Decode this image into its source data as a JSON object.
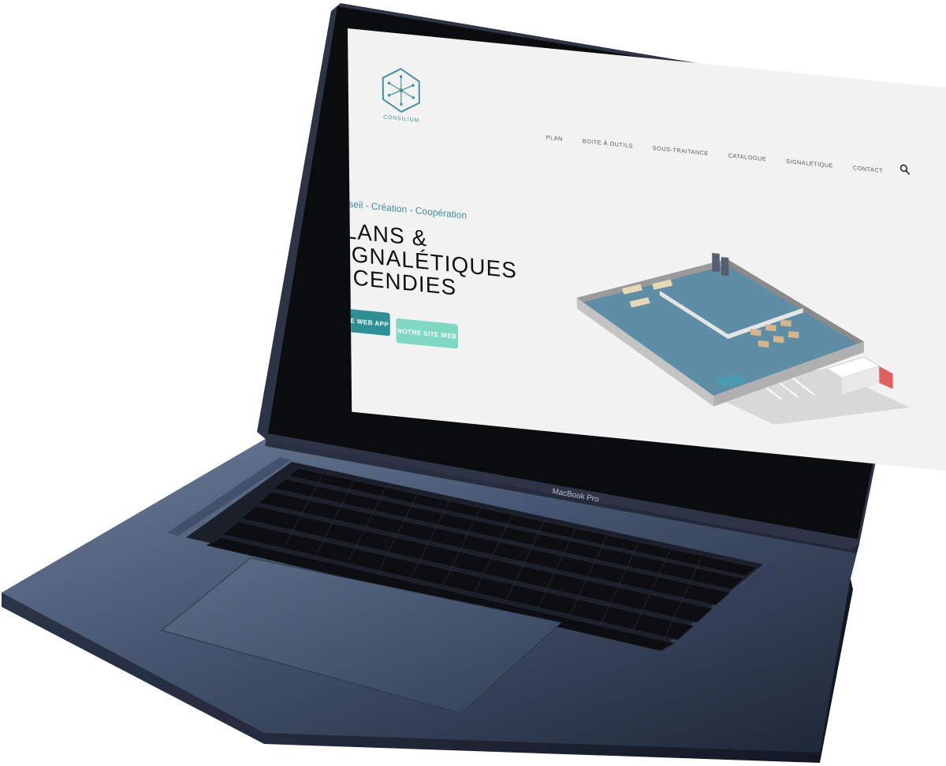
{
  "laptop": {
    "model_label": "MacBook Pro",
    "colors": {
      "body": "#3a4a62",
      "screen_bezel": "#0d0d0f",
      "keys": "#111216"
    }
  },
  "site": {
    "logo": {
      "text": "CONSILIUM",
      "icon": "hexagon-network-logo-icon",
      "color": "#3d8f9a"
    },
    "nav": {
      "items": [
        "PLAN",
        "BOITE À OUTILS",
        "SOUS-TRAITANCE",
        "CATALOGUE",
        "SIGNALÉTIQUE",
        "CONTACT"
      ],
      "search_icon": "search-icon"
    },
    "hero": {
      "tagline": "Conseil - Création - Coopération",
      "headline": [
        "PLANS &",
        "SIGNALÉTIQUES",
        "INCENDIES"
      ],
      "primary_button": "NOTRE WEB APP",
      "secondary_button": "NOTRE SITE WEB",
      "illustration": "isometric-building-floor-plan"
    },
    "colors": {
      "accent": "#2e8f96",
      "accent_light": "#7fd9c2",
      "background": "#f2f2f2"
    }
  }
}
